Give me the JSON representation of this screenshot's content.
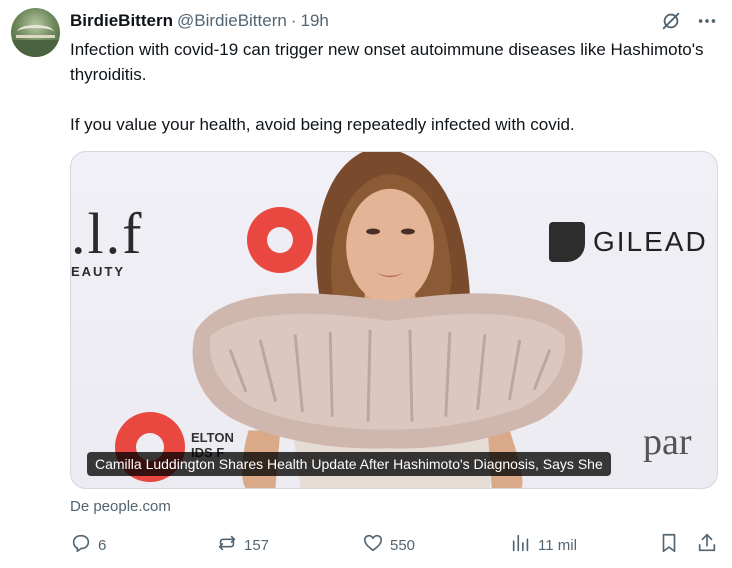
{
  "author": {
    "display_name": "BirdieBittern",
    "handle": "@BirdieBittern",
    "separator": "·",
    "time": "19h"
  },
  "tweet": {
    "paragraph1": "Infection with covid-19 can trigger new onset autoimmune diseases like Hashimoto's thyroiditis.",
    "paragraph2": "If you value your health, avoid being repeatedly infected with covid."
  },
  "card": {
    "caption": "Camilla Luddington Shares Health Update After Hashimoto's Diagnosis, Says She",
    "source": "De people.com",
    "backdrop": {
      "elf": ".l.f",
      "elf_sub": "EAUTY",
      "gilead": "GILEAD",
      "elton_line1": "ELTON",
      "elton_line2": "IDS F",
      "pan": "par"
    }
  },
  "actions": {
    "replies": "6",
    "reposts": "157",
    "likes": "550",
    "views": "11 mil"
  },
  "icons": [
    "grok-icon",
    "more-icon",
    "reply-icon",
    "repost-icon",
    "like-icon",
    "views-icon",
    "bookmark-icon",
    "share-icon"
  ],
  "colors": {
    "text": "#0f1419",
    "secondary": "#536471",
    "border": "#cfd9de"
  }
}
